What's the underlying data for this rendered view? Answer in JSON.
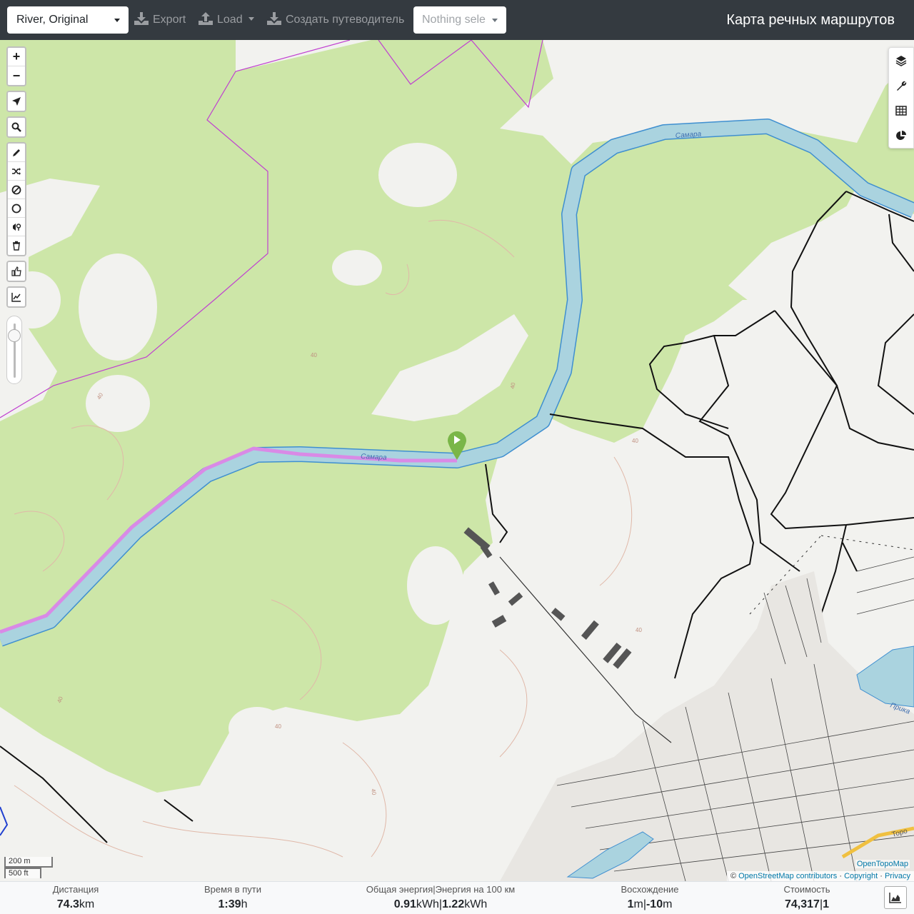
{
  "header": {
    "profile_select": "River, Original",
    "export_label": "Export",
    "load_label": "Load",
    "guide_label": "Создать путеводитель",
    "nothing_selected": "Nothing sele",
    "app_title": "Карта речных маршрутов"
  },
  "map": {
    "zoom_in": "+",
    "zoom_out": "−",
    "river_label": "Самара",
    "river_label_2": "Самара",
    "lake_label": "Прика",
    "road_label": "Торо",
    "contour_labels": [
      "40",
      "40",
      "40",
      "40",
      "40",
      "40",
      "40",
      "40"
    ],
    "scale_metric": "200 m",
    "scale_imperial": "500 ft",
    "attribution_prefix": "© ",
    "attribution_osm": "OpenStreetMap contributors",
    "attribution_sep1": " · ",
    "attribution_copyright": "Copyright",
    "attribution_sep2": " · ",
    "attribution_privacy": "Privacy",
    "opentopomap": "OpenTopoMap",
    "colors": {
      "forest": "#cde6a8",
      "water": "#aad3df",
      "route": "#d98ae6",
      "boundary": "#c040d0",
      "marker": "#7ab648"
    }
  },
  "stats": {
    "distance": {
      "label": "Дистанция",
      "value": "74.3",
      "unit": "km"
    },
    "time": {
      "label": "Время в пути",
      "value": "1:39",
      "unit": "h"
    },
    "energy": {
      "label": "Общая энергия|Энергия на 100 км",
      "value1": "0.91",
      "unit1": "kWh",
      "sep": "|",
      "value2": "1.22",
      "unit2": "kWh"
    },
    "ascent": {
      "label": "Восхождение",
      "value1": "1",
      "unit1": "m",
      "sep": "|",
      "value2": "-10",
      "unit2": "m"
    },
    "cost": {
      "label": "Стоимость",
      "value": "74,317",
      "sep": "|",
      "value2": "1"
    }
  }
}
